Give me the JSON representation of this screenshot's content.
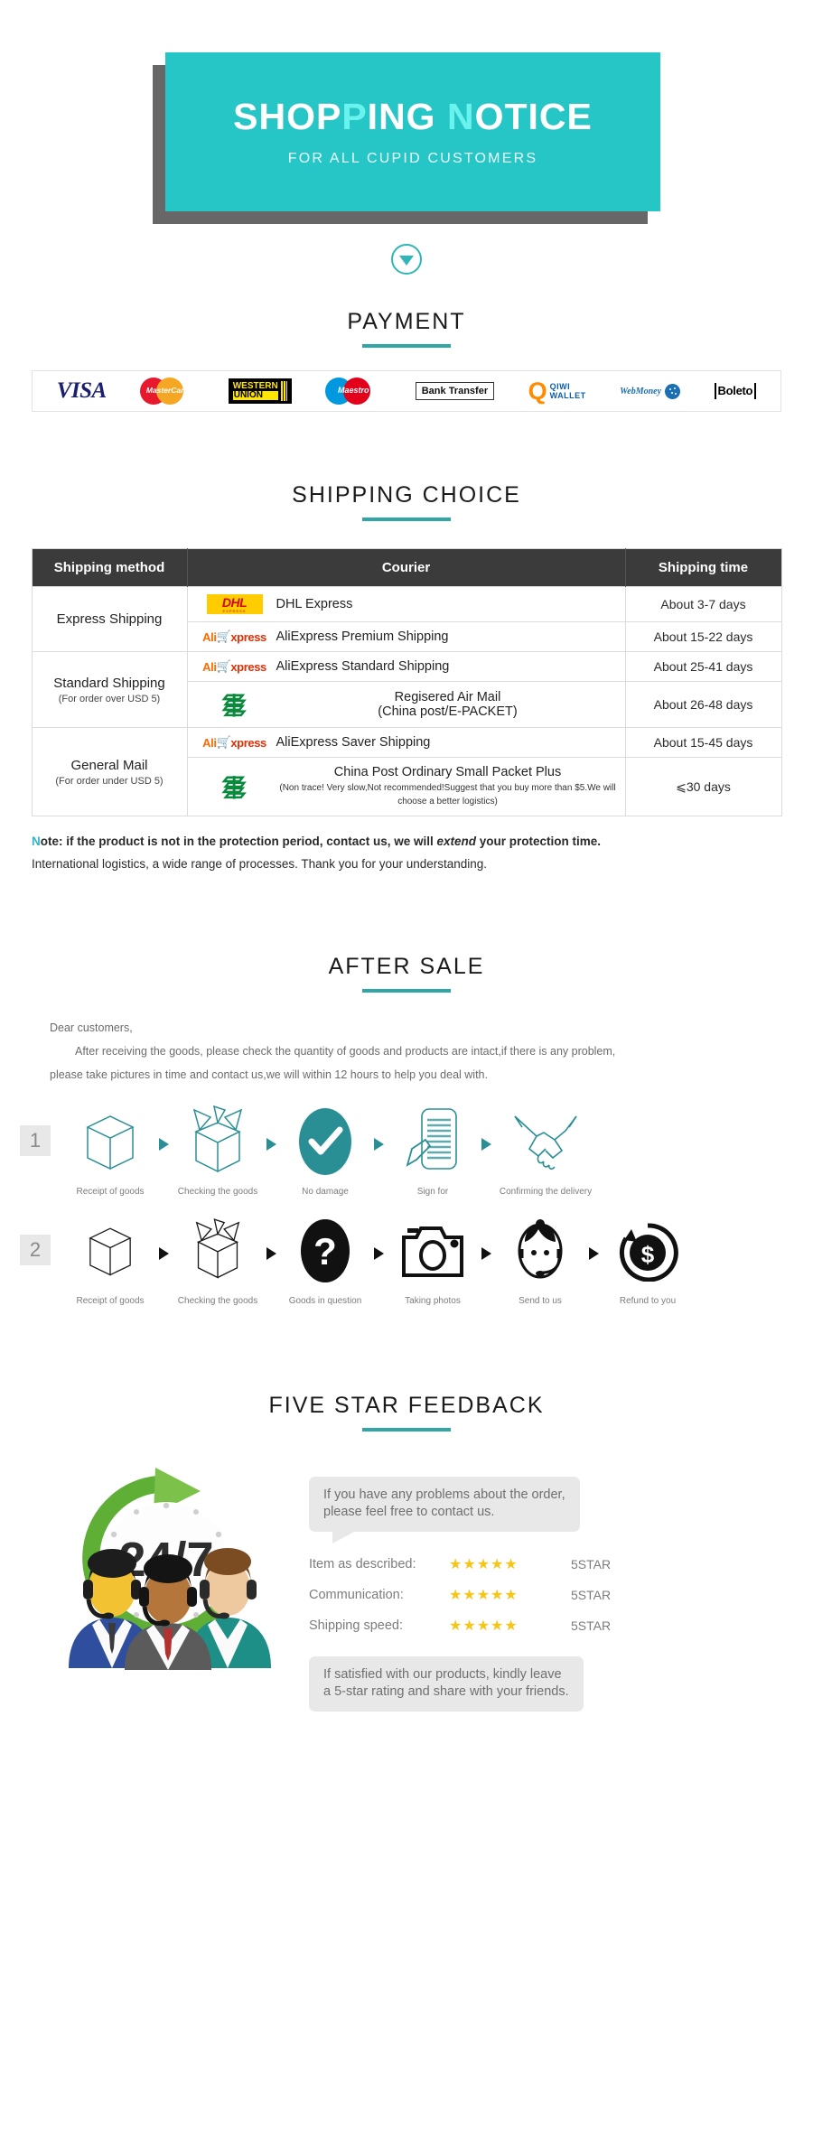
{
  "hero": {
    "title_parts": [
      {
        "text": "SHOP",
        "accent": false
      },
      {
        "text": "P",
        "accent": true
      },
      {
        "text": "ING ",
        "accent": false
      },
      {
        "text": "N",
        "accent": true
      },
      {
        "text": "OTICE",
        "accent": false
      }
    ],
    "title_plain": "SHOPPING NOTICE",
    "subtitle": "FOR ALL CUPID CUSTOMERS",
    "bg_color": "#26c6c6",
    "accent_color": "#6af2ef",
    "shadow_color": "#666766"
  },
  "arrow": {
    "icon": "chevron-down-icon",
    "color": "#2fb6b6"
  },
  "payment": {
    "title": "PAYMENT",
    "methods": [
      {
        "name": "visa-logo",
        "label": "VISA"
      },
      {
        "name": "mastercard-logo",
        "label": "MasterCard"
      },
      {
        "name": "western-union-logo",
        "label_1": "WESTERN",
        "label_2": "UNION"
      },
      {
        "name": "maestro-logo",
        "label": "Maestro"
      },
      {
        "name": "bank-transfer-logo",
        "label": "Bank Transfer"
      },
      {
        "name": "qiwi-wallet-logo",
        "label_1": "QIWI",
        "label_2": "WALLET"
      },
      {
        "name": "webmoney-logo",
        "label": "WebMoney"
      },
      {
        "name": "boleto-logo",
        "label": "Boleto"
      }
    ]
  },
  "shipping": {
    "title": "SHIPPING CHOICE",
    "headers": [
      "Shipping method",
      "Courier",
      "Shipping time"
    ],
    "groups": [
      {
        "method": "Express Shipping",
        "method_sub": "",
        "rows": [
          {
            "logo": "dhl-logo",
            "courier": "DHL Express",
            "courier_sub": "",
            "time": "About 3-7 days",
            "centered": false
          },
          {
            "logo": "aliexpress-logo",
            "courier": "AliExpress Premium Shipping",
            "courier_sub": "",
            "time": "About 15-22 days",
            "centered": false
          }
        ]
      },
      {
        "method": "Standard Shipping",
        "method_sub": "(For order over USD 5)",
        "rows": [
          {
            "logo": "aliexpress-logo",
            "courier": "AliExpress Standard Shipping",
            "courier_sub": "",
            "time": "About 25-41 days",
            "centered": false
          },
          {
            "logo": "china-post-logo",
            "courier": "Regisered Air Mail",
            "courier_sub": "(China post/E-PACKET)",
            "time": "About 26-48 days",
            "centered": true
          }
        ]
      },
      {
        "method": "General Mail",
        "method_sub": "(For order under USD 5)",
        "rows": [
          {
            "logo": "aliexpress-logo",
            "courier": "AliExpress Saver Shipping",
            "courier_sub": "",
            "time": "About 15-45 days",
            "centered": false
          },
          {
            "logo": "china-post-logo",
            "courier": "China Post Ordinary Small Packet Plus",
            "courier_sub": "(Non trace!  Very slow,Not recommended!Suggest that you buy more than $5.We will choose a better logistics)",
            "time": "⩽30 days",
            "centered": true
          }
        ]
      }
    ],
    "note_prefix_bold": "N",
    "note_line1_a": "ote: if the product is not in the protection period, contact us, we will ",
    "note_line1_italic": "extend",
    "note_line1_b": " your protection time.",
    "note_line2": "International logistics, a wide range of processes. Thank you for your understanding."
  },
  "after_sale": {
    "title": "AFTER SALE",
    "greeting": "Dear customers,",
    "paragraph": "After receiving the goods, please check the quantity of goods and products are intact,if there is any problem,",
    "paragraph2": "please take pictures in time and contact us,we will within 12 hours to help you deal with.",
    "flow1": {
      "number": "1",
      "steps": [
        {
          "icon": "box-icon",
          "label": "Receipt of goods"
        },
        {
          "icon": "open-box-icon",
          "label": "Checking the goods"
        },
        {
          "icon": "check-circle-icon",
          "label": "No damage"
        },
        {
          "icon": "document-sign-icon",
          "label": "Sign for"
        },
        {
          "icon": "handshake-icon",
          "label": "Confirming the delivery"
        }
      ]
    },
    "flow2": {
      "number": "2",
      "steps": [
        {
          "icon": "box-icon",
          "label": "Receipt of goods"
        },
        {
          "icon": "open-box-icon",
          "label": "Checking the goods"
        },
        {
          "icon": "question-circle-icon",
          "label": "Goods in question"
        },
        {
          "icon": "camera-icon",
          "label": "Taking photos"
        },
        {
          "icon": "support-agent-icon",
          "label": "Send to us"
        },
        {
          "icon": "refund-dollar-icon",
          "label": "Refund to you"
        }
      ]
    }
  },
  "feedback": {
    "title": "FIVE STAR FEEDBACK",
    "support_badge": {
      "icon": "support-24-7-icon",
      "text": "24/7"
    },
    "bubble_top_line1": "If you have any problems about the order,",
    "bubble_top_line2": "please feel free to contact us.",
    "ratings": [
      {
        "label": "Item as described:",
        "stars": "★★★★★",
        "value": "5STAR"
      },
      {
        "label": "Communication:",
        "stars": "★★★★★",
        "value": "5STAR"
      },
      {
        "label": "Shipping speed:",
        "stars": "★★★★★",
        "value": "5STAR"
      }
    ],
    "bubble_bottom_line1": "If satisfied with our products, kindly leave",
    "bubble_bottom_line2": "a 5-star rating and share with your friends.",
    "star_color": "#f5c518"
  }
}
